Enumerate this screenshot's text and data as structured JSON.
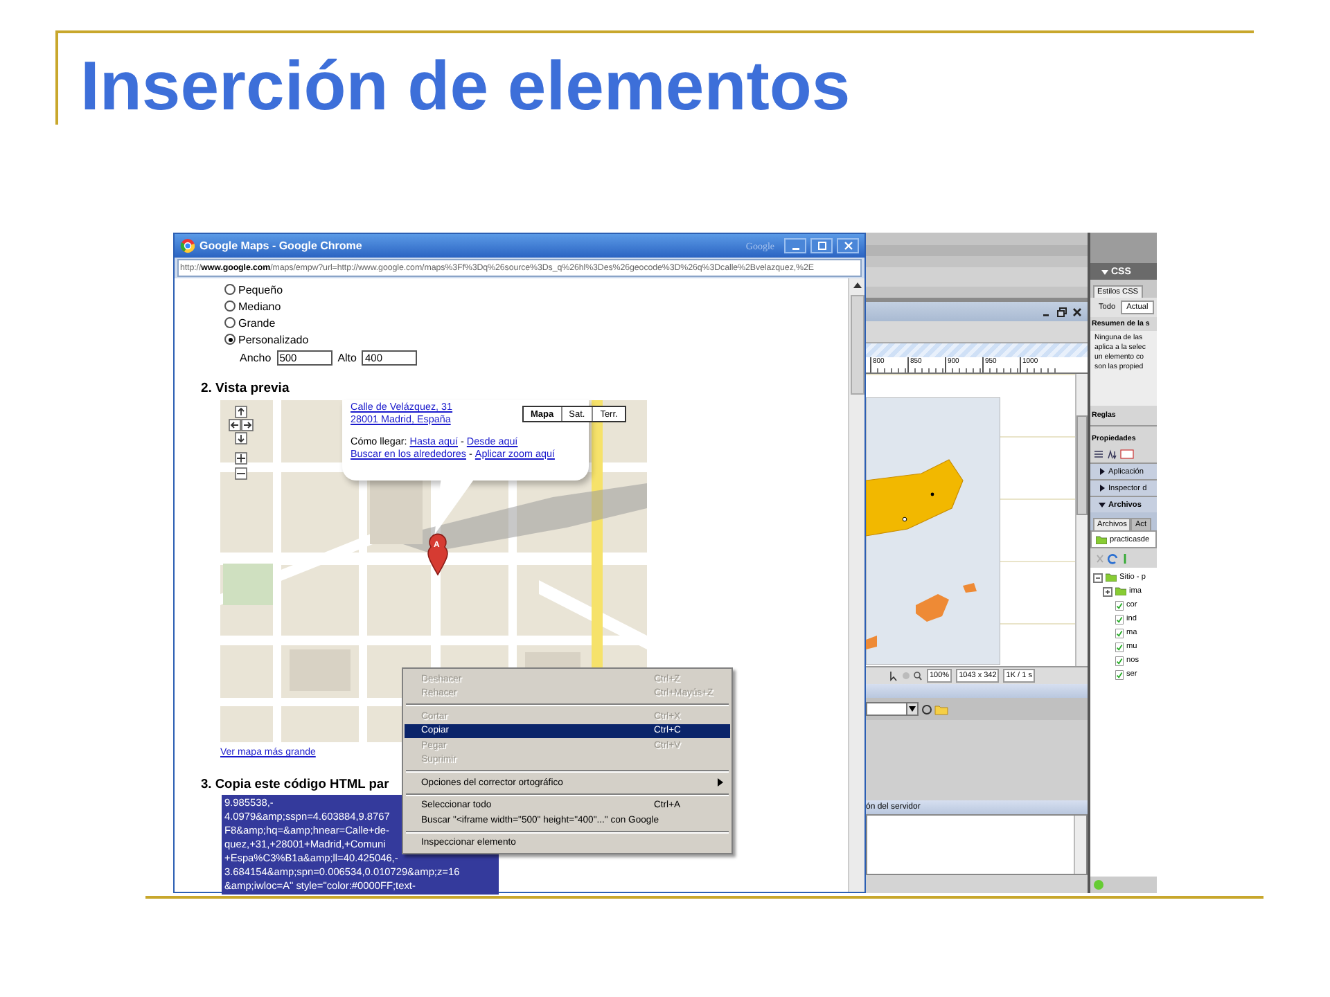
{
  "slide": {
    "title": "Inserción de elementos"
  },
  "browser": {
    "title": "Google Maps - Google Chrome",
    "brand_text": "Google",
    "url": "http://**www.google.com**/maps/empw?url=http://www.google.com/maps%3Ff%3Dq%26source%3Ds_q%26hl%3Des%26geocode%3D%26q%3Dcalle%2Bvelazquez,%2E"
  },
  "size_options": [
    {
      "label": "Pequeño",
      "selected": false
    },
    {
      "label": "Mediano",
      "selected": false
    },
    {
      "label": "Grande",
      "selected": false
    },
    {
      "label": "Personalizado",
      "selected": true
    }
  ],
  "custom_size": {
    "width_label": "Ancho",
    "width_value": "500",
    "height_label": "Alto",
    "height_value": "400"
  },
  "preview": {
    "heading": "2. Vista previa",
    "map_types": [
      {
        "label": "Mapa",
        "selected": true
      },
      {
        "label": "Sat.",
        "selected": false
      },
      {
        "label": "Terr.",
        "selected": false
      }
    ],
    "bubble": {
      "address_lines": [
        "Calle de Velázquez, 31",
        "28001 Madrid, España"
      ],
      "link_lines": [
        [
          {
            "kind": "text",
            "text": "Cómo llegar:"
          },
          {
            "kind": "link",
            "text": "Hasta aquí"
          },
          {
            "kind": "text",
            "text": "-"
          },
          {
            "kind": "link",
            "text": "Desde aquí"
          }
        ],
        [
          {
            "kind": "link",
            "text": "Buscar en los alrededores"
          },
          {
            "kind": "text",
            "text": "-"
          },
          {
            "kind": "link",
            "text": "Aplicar zoom aquí"
          }
        ]
      ]
    },
    "marker_label": "A",
    "larger_map_link": "Ver mapa más grande"
  },
  "code_section": {
    "heading": "3. Copia este código HTML par",
    "code_lines": [
      "9.985538,-",
      "4.0979&amp;sspn=4.603884,9.8767",
      "F8&amp;hq=&amp;hnear=Calle+de-",
      "quez,+31,+28001+Madrid,+Comuni",
      "+Espa%C3%B1a&amp;ll=40.425046,-",
      "3.684154&amp;spn=0.006534,0.010729&amp;z=16",
      "&amp;iwloc=A\" style=\"color:#0000FF;text-"
    ]
  },
  "context_menu": [
    {
      "kind": "item",
      "label": "Deshacer",
      "shortcut": "Ctrl+Z",
      "disabled": true,
      "selected": false
    },
    {
      "kind": "item",
      "label": "Rehacer",
      "shortcut": "Ctrl+Mayús+Z",
      "disabled": true,
      "selected": false
    },
    {
      "kind": "separator"
    },
    {
      "kind": "item",
      "label": "Cortar",
      "shortcut": "Ctrl+X",
      "disabled": true,
      "selected": false
    },
    {
      "kind": "item",
      "label": "Copiar",
      "shortcut": "Ctrl+C",
      "disabled": false,
      "selected": true
    },
    {
      "kind": "item",
      "label": "Pegar",
      "shortcut": "Ctrl+V",
      "disabled": true,
      "selected": false
    },
    {
      "kind": "item",
      "label": "Suprimir",
      "disabled": true,
      "selected": false
    },
    {
      "kind": "separator"
    },
    {
      "kind": "submenu",
      "label": "Opciones del corrector ortográfico",
      "disabled": false,
      "selected": false
    },
    {
      "kind": "separator"
    },
    {
      "kind": "item",
      "label": "Seleccionar todo",
      "shortcut": "Ctrl+A",
      "disabled": false,
      "selected": false
    },
    {
      "kind": "item",
      "label": "Buscar \"<iframe width=\"500\" height=\"400\"...\" con Google",
      "disabled": false,
      "selected": false
    },
    {
      "kind": "separator"
    },
    {
      "kind": "item",
      "label": "Inspeccionar elemento",
      "disabled": false,
      "selected": false
    }
  ],
  "editor": {
    "ruler_ticks": [
      "800",
      "850",
      "900",
      "950",
      "1000"
    ],
    "zoom": "100%",
    "window_size": "1043 x 342",
    "download": "1K / 1 s",
    "panel_title": "ón del servidor"
  },
  "side_panel": {
    "css_header": {
      "label": "CSS",
      "expanded": true
    },
    "style_tabs": [
      {
        "label": "Estilos CSS",
        "selected": true
      }
    ],
    "mode_tabs": [
      {
        "label": "Todo",
        "selected": false
      },
      {
        "label": "Actual",
        "selected": true
      }
    ],
    "summary_title": "Resumen de la s",
    "summary_lines": [
      "Ninguna de las",
      "aplica a la selec",
      "un elemento co",
      "son las propied"
    ],
    "rules_label": "Reglas",
    "properties_label": "Propiedades",
    "sections": [
      {
        "label": "Aplicación",
        "expanded": false
      },
      {
        "label": "Inspector d",
        "expanded": false
      },
      {
        "label": "Archivos",
        "expanded": true
      }
    ],
    "file_tabs": [
      {
        "label": "Archivos",
        "selected": true
      },
      {
        "label": "Act",
        "selected": false
      }
    ],
    "site_select": "practicasde",
    "tree": [
      {
        "label": "Sitio - p",
        "kind": "site",
        "expanded": true,
        "children": [
          {
            "label": "ima",
            "kind": "folder",
            "expanded": false
          },
          {
            "label": "cor",
            "kind": "file"
          },
          {
            "label": "ind",
            "kind": "file"
          },
          {
            "label": "ma",
            "kind": "file"
          },
          {
            "label": "mu",
            "kind": "file"
          },
          {
            "label": "nos",
            "kind": "file"
          },
          {
            "label": "ser",
            "kind": "file"
          }
        ]
      }
    ]
  }
}
